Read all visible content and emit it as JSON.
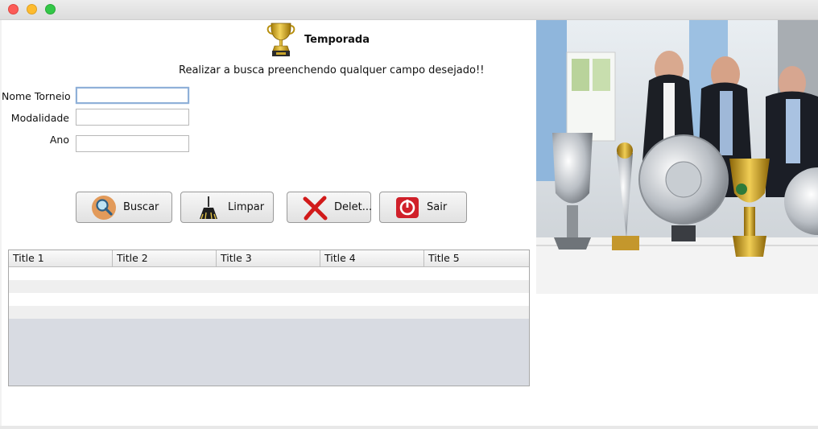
{
  "window": {
    "controls": [
      "close",
      "minimize",
      "maximize"
    ]
  },
  "header": {
    "title": "Temporada",
    "icon": "trophy-icon",
    "instructions": "Realizar a busca preenchendo qualquer campo desejado!!"
  },
  "form": {
    "fields": [
      {
        "label": "Nome Torneio",
        "value": ""
      },
      {
        "label": "Modalidade",
        "value": ""
      },
      {
        "label": "Ano",
        "value": ""
      }
    ]
  },
  "buttons": [
    {
      "label": "Buscar",
      "icon": "magnifier-icon"
    },
    {
      "label": "Limpar",
      "icon": "broom-icon"
    },
    {
      "label": "Delet...",
      "icon": "red-x-icon"
    },
    {
      "label": "Sair",
      "icon": "power-icon"
    }
  ],
  "table": {
    "columns": [
      "Title 1",
      "Title 2",
      "Title 3",
      "Title 4",
      "Title 5"
    ],
    "rows": [
      [
        "",
        "",
        "",
        "",
        ""
      ],
      [
        "",
        "",
        "",
        "",
        ""
      ],
      [
        "",
        "",
        "",
        "",
        ""
      ],
      [
        "",
        "",
        "",
        "",
        ""
      ]
    ]
  },
  "photo": {
    "subject": "trophies-photo"
  },
  "colors": {
    "header_gradient_top": "#fafafa",
    "table_empty_bg": "#d8dbe2",
    "focus_ring": "#8fb0d8"
  }
}
